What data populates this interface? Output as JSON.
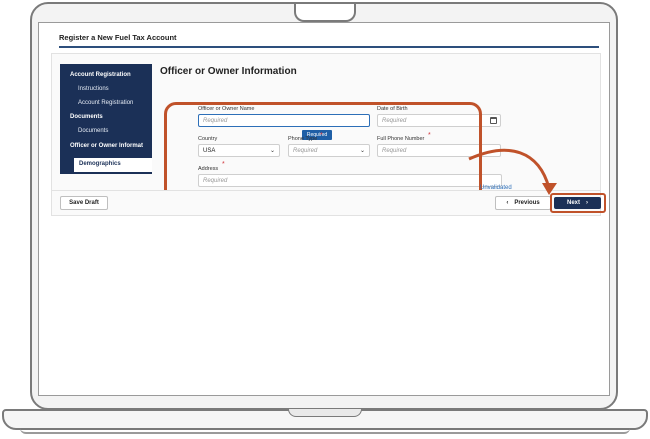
{
  "app": {
    "title": "Register a New Fuel Tax Account"
  },
  "sidebar": {
    "sections": [
      {
        "label": "Account Registration",
        "items": [
          {
            "label": "Instructions"
          },
          {
            "label": "Account Registration"
          }
        ]
      },
      {
        "label": "Documents",
        "items": [
          {
            "label": "Documents"
          }
        ]
      },
      {
        "label": "Officer or Owner Informat",
        "items": [
          {
            "label": "Demographics",
            "active": true
          }
        ]
      }
    ]
  },
  "form": {
    "title": "Officer or Owner Information",
    "owner_name": {
      "label": "Officer or Owner Name",
      "placeholder": "Required",
      "tooltip": "Required"
    },
    "date_of_birth": {
      "label": "Date of Birth",
      "placeholder": "Required",
      "icon": "calendar-icon"
    },
    "country": {
      "label": "Country",
      "value": "USA"
    },
    "phone_type": {
      "label": "Phone Type",
      "placeholder": "Required"
    },
    "full_phone": {
      "label": "Full Phone Number",
      "placeholder": "Required"
    },
    "address": {
      "label": "Address",
      "placeholder": "Required"
    },
    "status": "Unvalidated"
  },
  "footer": {
    "save_draft": "Save Draft",
    "previous": "Previous",
    "next": "Next",
    "prev_icon": "‹",
    "next_icon": "›"
  },
  "colors": {
    "nav_bg": "#1b3057",
    "accent": "#2d6fb8",
    "highlight": "#c0522a",
    "required": "#d0343b"
  }
}
